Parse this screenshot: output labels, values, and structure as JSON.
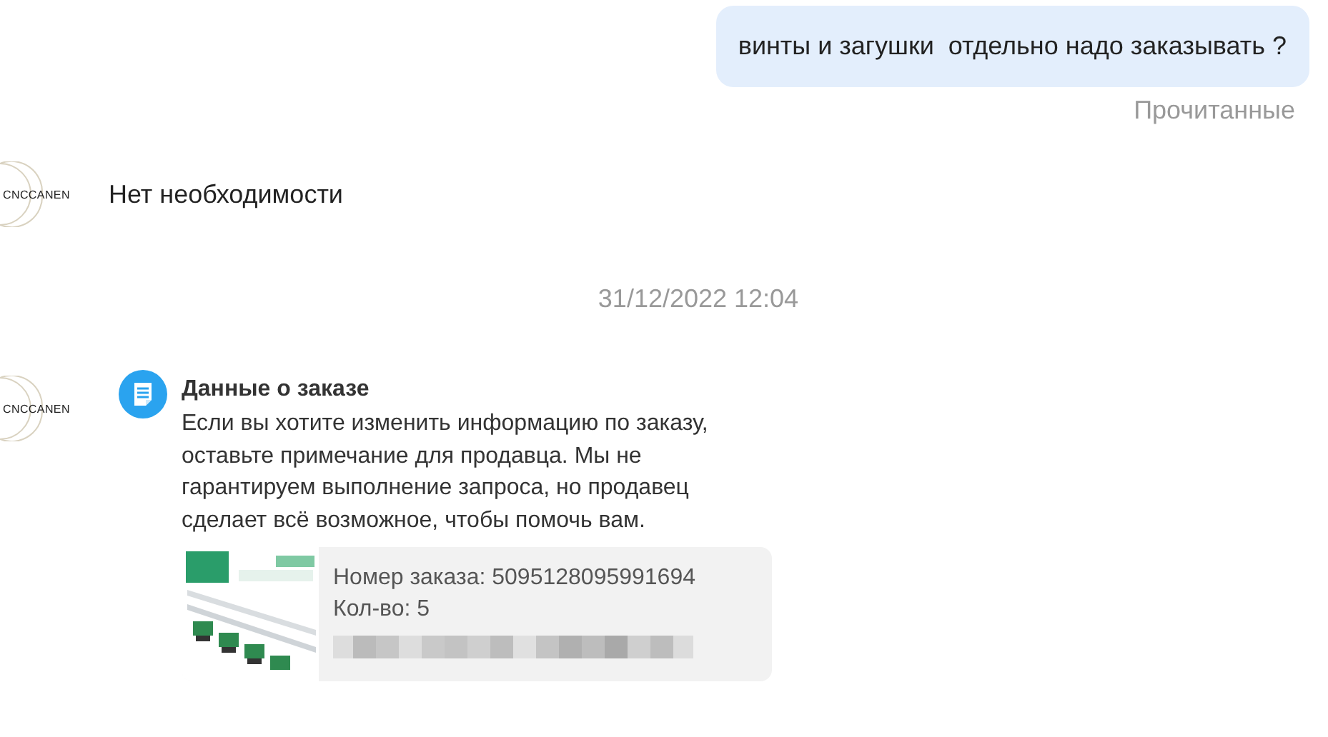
{
  "messages": [
    {
      "kind": "outgoing",
      "text": "винты и загушки  отдельно надо заказывать ?",
      "status": "Прочитанные"
    },
    {
      "kind": "incoming",
      "avatar": "CNCCANEN",
      "text": "Нет необходимости"
    },
    {
      "kind": "timestamp",
      "text": "31/12/2022 12:04"
    },
    {
      "kind": "order",
      "avatar": "CNCCANEN",
      "title": "Данные о заказе",
      "body": "Если вы хотите изменить информацию по заказу, оставьте примечание для продавца. Мы не гарантируем выполнение запроса, но продавец сделает всё возможное, чтобы помочь вам.",
      "order_number": "Номер заказа: 5095128095991694",
      "quantity": "Кол-во: 5"
    }
  ]
}
